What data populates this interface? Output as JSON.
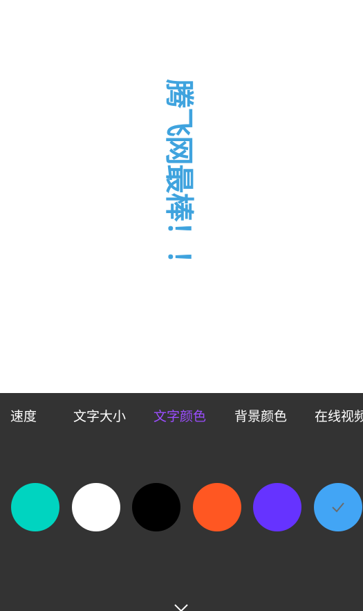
{
  "preview": {
    "text": "腾飞网最棒！！",
    "text_color": "#3fa3de"
  },
  "tabs": [
    {
      "label": "速度",
      "active": false
    },
    {
      "label": "文字大小",
      "active": false
    },
    {
      "label": "文字颜色",
      "active": true
    },
    {
      "label": "背景颜色",
      "active": false
    },
    {
      "label": "在线视频",
      "active": false
    }
  ],
  "accent_color": "#9b4dff",
  "swatches": [
    {
      "color": "#00d4c0",
      "selected": false
    },
    {
      "color": "#ffffff",
      "selected": false
    },
    {
      "color": "#000000",
      "selected": false
    },
    {
      "color": "#ff5722",
      "selected": false
    },
    {
      "color": "#6633ff",
      "selected": false
    },
    {
      "color": "#42a5f5",
      "selected": true
    }
  ],
  "icons": {
    "check": "check-icon",
    "collapse": "chevron-down-icon"
  }
}
